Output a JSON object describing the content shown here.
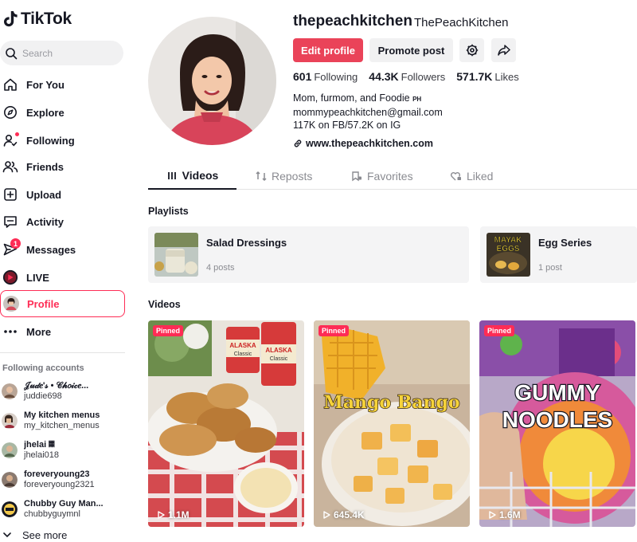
{
  "app": {
    "logo_text": "TikTok"
  },
  "search": {
    "placeholder": "Search"
  },
  "nav": {
    "for_you": "For You",
    "explore": "Explore",
    "following": "Following",
    "friends": "Friends",
    "upload": "Upload",
    "activity": "Activity",
    "messages": "Messages",
    "messages_badge": "1",
    "live": "LIVE",
    "profile": "Profile",
    "more": "More"
  },
  "following_accounts": {
    "title": "Following accounts",
    "items": [
      {
        "name": "𝒥𝓊𝒹𝑒'𝓈 • 𝒞𝒽𝑜𝒾𝒸𝑒...",
        "username": "juddie698"
      },
      {
        "name": "My kitchen menus",
        "username": "my_kitchen_menus"
      },
      {
        "name": "jhelai 𝄜",
        "username": "jhelai018"
      },
      {
        "name": "foreveryoung23",
        "username": "foreveryoung2321"
      },
      {
        "name": "Chubby Guy Man...",
        "username": "chubbyguymnl"
      }
    ],
    "see_more": "See more"
  },
  "profile": {
    "username": "thepeachkitchen",
    "nickname": "ThePeachKitchen",
    "edit_label": "Edit profile",
    "promote_label": "Promote post",
    "stats": {
      "following_value": "601",
      "following_label": "Following",
      "followers_value": "44.3K",
      "followers_label": "Followers",
      "likes_value": "571.7K",
      "likes_label": "Likes"
    },
    "bio": {
      "line1": "Mom, furmom, and Foodie",
      "line1_flag": "PH",
      "line2": "mommypeachkitchen@gmail.com",
      "line3": "117K on FB/57.2K on IG"
    },
    "link": "www.thepeachkitchen.com"
  },
  "tabs": {
    "videos": "Videos",
    "reposts": "Reposts",
    "favorites": "Favorites",
    "liked": "Liked"
  },
  "playlists": {
    "title": "Playlists",
    "items": [
      {
        "name": "Salad Dressings",
        "count": "4 posts"
      },
      {
        "name": "Egg Series",
        "count": "1 post"
      }
    ]
  },
  "videos": {
    "title": "Videos",
    "items": [
      {
        "pinned": "Pinned",
        "views": "1.1M"
      },
      {
        "pinned": "Pinned",
        "views": "645.4K",
        "overlay": "Mango Bango"
      },
      {
        "pinned": "Pinned",
        "views": "1.6M",
        "overlay_line1": "GUMMY",
        "overlay_line2": "NOODLES"
      }
    ]
  },
  "thumb_text": {
    "egg_line1": "MAYAK",
    "egg_line2": "EGGS",
    "can_brand": "ALASKA",
    "can_sub": "Classic"
  },
  "colors": {
    "accent": "#fe2c55",
    "edit_button": "#ea4359"
  }
}
